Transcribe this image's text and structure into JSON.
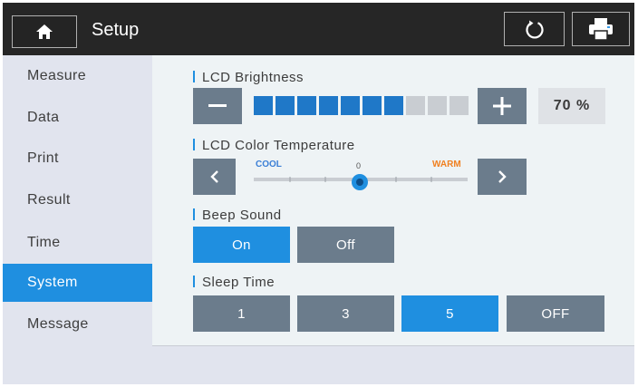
{
  "header": {
    "title": "Setup",
    "home_icon": "home-icon",
    "refresh_icon": "refresh-icon",
    "print_icon": "printer-icon"
  },
  "sidebar": {
    "items": [
      {
        "label": "Measure",
        "active": false
      },
      {
        "label": "Data",
        "active": false
      },
      {
        "label": "Print",
        "active": false
      },
      {
        "label": "Result",
        "active": false
      },
      {
        "label": "Time",
        "active": false
      },
      {
        "label": "System",
        "active": true
      },
      {
        "label": "Message",
        "active": false
      }
    ]
  },
  "lcd_brightness": {
    "label": "LCD Brightness",
    "level_filled": 7,
    "level_total": 10,
    "value_text": "70 %"
  },
  "lcd_color_temperature": {
    "label": "LCD Color Temperature",
    "cool_label": "COOL",
    "center_label": "0",
    "warm_label": "WARM",
    "value": 0,
    "cool_color": "#3b7fd6",
    "warm_color": "#f08020"
  },
  "beep_sound": {
    "label": "Beep Sound",
    "options": [
      "On",
      "Off"
    ],
    "selected": "On"
  },
  "sleep_time": {
    "label": "Sleep Time",
    "options": [
      "1",
      "3",
      "5",
      "OFF"
    ],
    "selected": "5"
  },
  "colors": {
    "accent": "#1f8fe0",
    "button_gray": "#6b7c8c",
    "header_bg": "#262626"
  }
}
